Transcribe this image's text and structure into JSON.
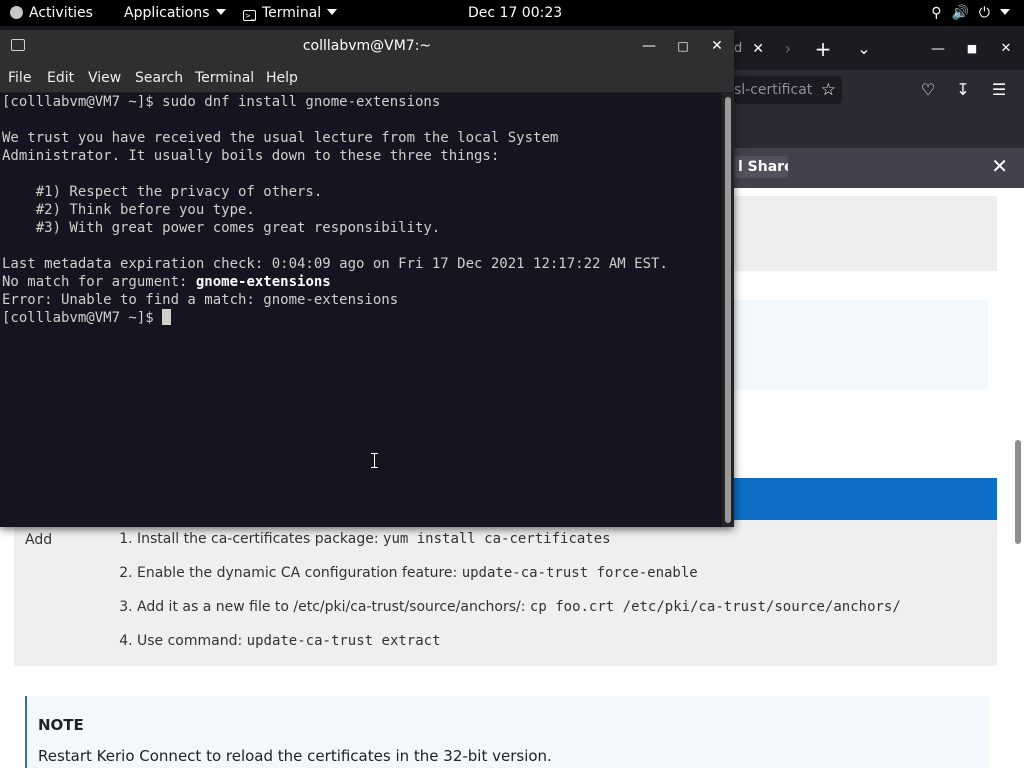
{
  "topbar": {
    "activities": "Activities",
    "applications": "Applications",
    "terminal_app": "Terminal",
    "clock": "Dec 17  00:23",
    "tray_network_icon": "network-icon",
    "tray_volume_icon": "volume-icon",
    "tray_power_icon": "power-icon"
  },
  "browser": {
    "tab_partial": "d",
    "url_partial": "sl-certificat",
    "share_partial": "l Share",
    "article": {
      "row_label": "Add",
      "steps": [
        {
          "text": "Install the ca-certificates package: ",
          "code": "yum install ca-certificates"
        },
        {
          "text": "Enable the dynamic CA configuration feature: ",
          "code": "update-ca-trust force-enable"
        },
        {
          "text": "Add it as a new file to /etc/pki/ca-trust/source/anchors/: ",
          "code": "cp foo.crt /etc/pki/ca-trust/source/anchors/"
        },
        {
          "text": "Use command: ",
          "code": "update-ca-trust extract"
        }
      ],
      "note_title": "NOTE",
      "note_body": "Restart Kerio Connect to reload the certificates in the 32-bit version."
    }
  },
  "terminal": {
    "title": "colllabvm@VM7:~",
    "menu": [
      "File",
      "Edit",
      "View",
      "Search",
      "Terminal",
      "Help"
    ],
    "lines": {
      "l1": "[colllabvm@VM7 ~]$ sudo dnf install gnome-extensions",
      "l2": "We trust you have received the usual lecture from the local System",
      "l3": "Administrator. It usually boils down to these three things:",
      "l4": "    #1) Respect the privacy of others.",
      "l5": "    #2) Think before you type.",
      "l6": "    #3) With great power comes great responsibility.",
      "l7": "Last metadata expiration check: 0:04:09 ago on Fri 17 Dec 2021 12:17:22 AM EST.",
      "l8_prefix": "No match for argument: ",
      "l8_bold": "gnome-extensions",
      "l9": "Error: Unable to find a match: gnome-extensions",
      "prompt": "[colllabvm@VM7 ~]$ "
    }
  }
}
